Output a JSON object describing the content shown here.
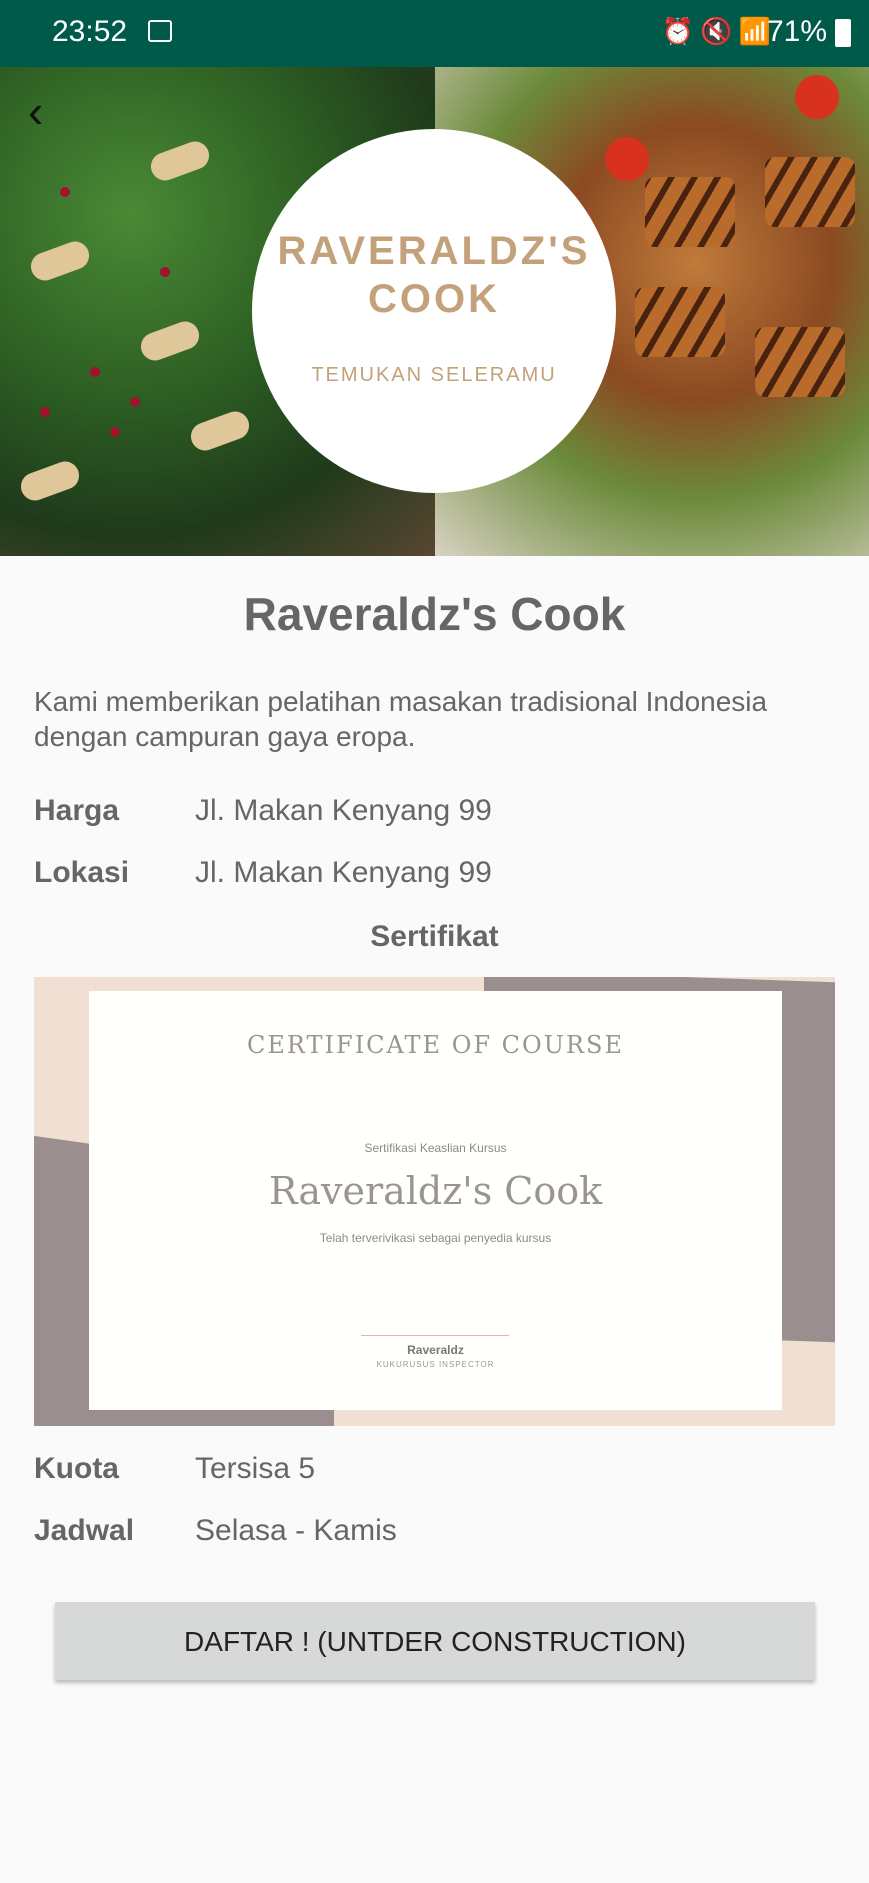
{
  "status_bar": {
    "time": "23:52",
    "battery": "71%",
    "icon_names": [
      "gallery-icon",
      "alarm-icon",
      "mute-icon",
      "wifi-icon",
      "signal-icon",
      "volte-icon",
      "signal-icon",
      "battery-icon"
    ]
  },
  "hero": {
    "logo_title": "RAVERALDZ'S COOK",
    "logo_subtitle": "TEMUKAN SELERAMU"
  },
  "detail": {
    "title": "Raveraldz's Cook",
    "description": "Kami memberikan pelatihan masakan tradisional Indonesia dengan campuran gaya eropa.",
    "harga_label": "Harga",
    "harga_value": "Jl. Makan Kenyang 99",
    "lokasi_label": "Lokasi",
    "lokasi_value": "Jl. Makan Kenyang 99",
    "sertifikat_label": "Sertifikat",
    "kuota_label": "Kuota",
    "kuota_value": "Tersisa 5",
    "jadwal_label": "Jadwal",
    "jadwal_value": "Selasa - Kamis"
  },
  "certificate": {
    "heading": "CERTIFICATE OF COURSE",
    "subheading": "Sertifikasi Keaslian Kursus",
    "name": "Raveraldz's Cook",
    "note": "Telah terverivikasi sebagai penyedia kursus",
    "signer": "Raveraldz",
    "signer_title": "KUKURUSUS INSPECTOR"
  },
  "action": {
    "register_label": "DAFTAR ! (UNTDER CONSTRUCTION)"
  },
  "colors": {
    "status_bar": "#005a4a",
    "logo_text": "#c3a17b",
    "body_text": "#666666",
    "button_bg": "#d7d8d8"
  }
}
